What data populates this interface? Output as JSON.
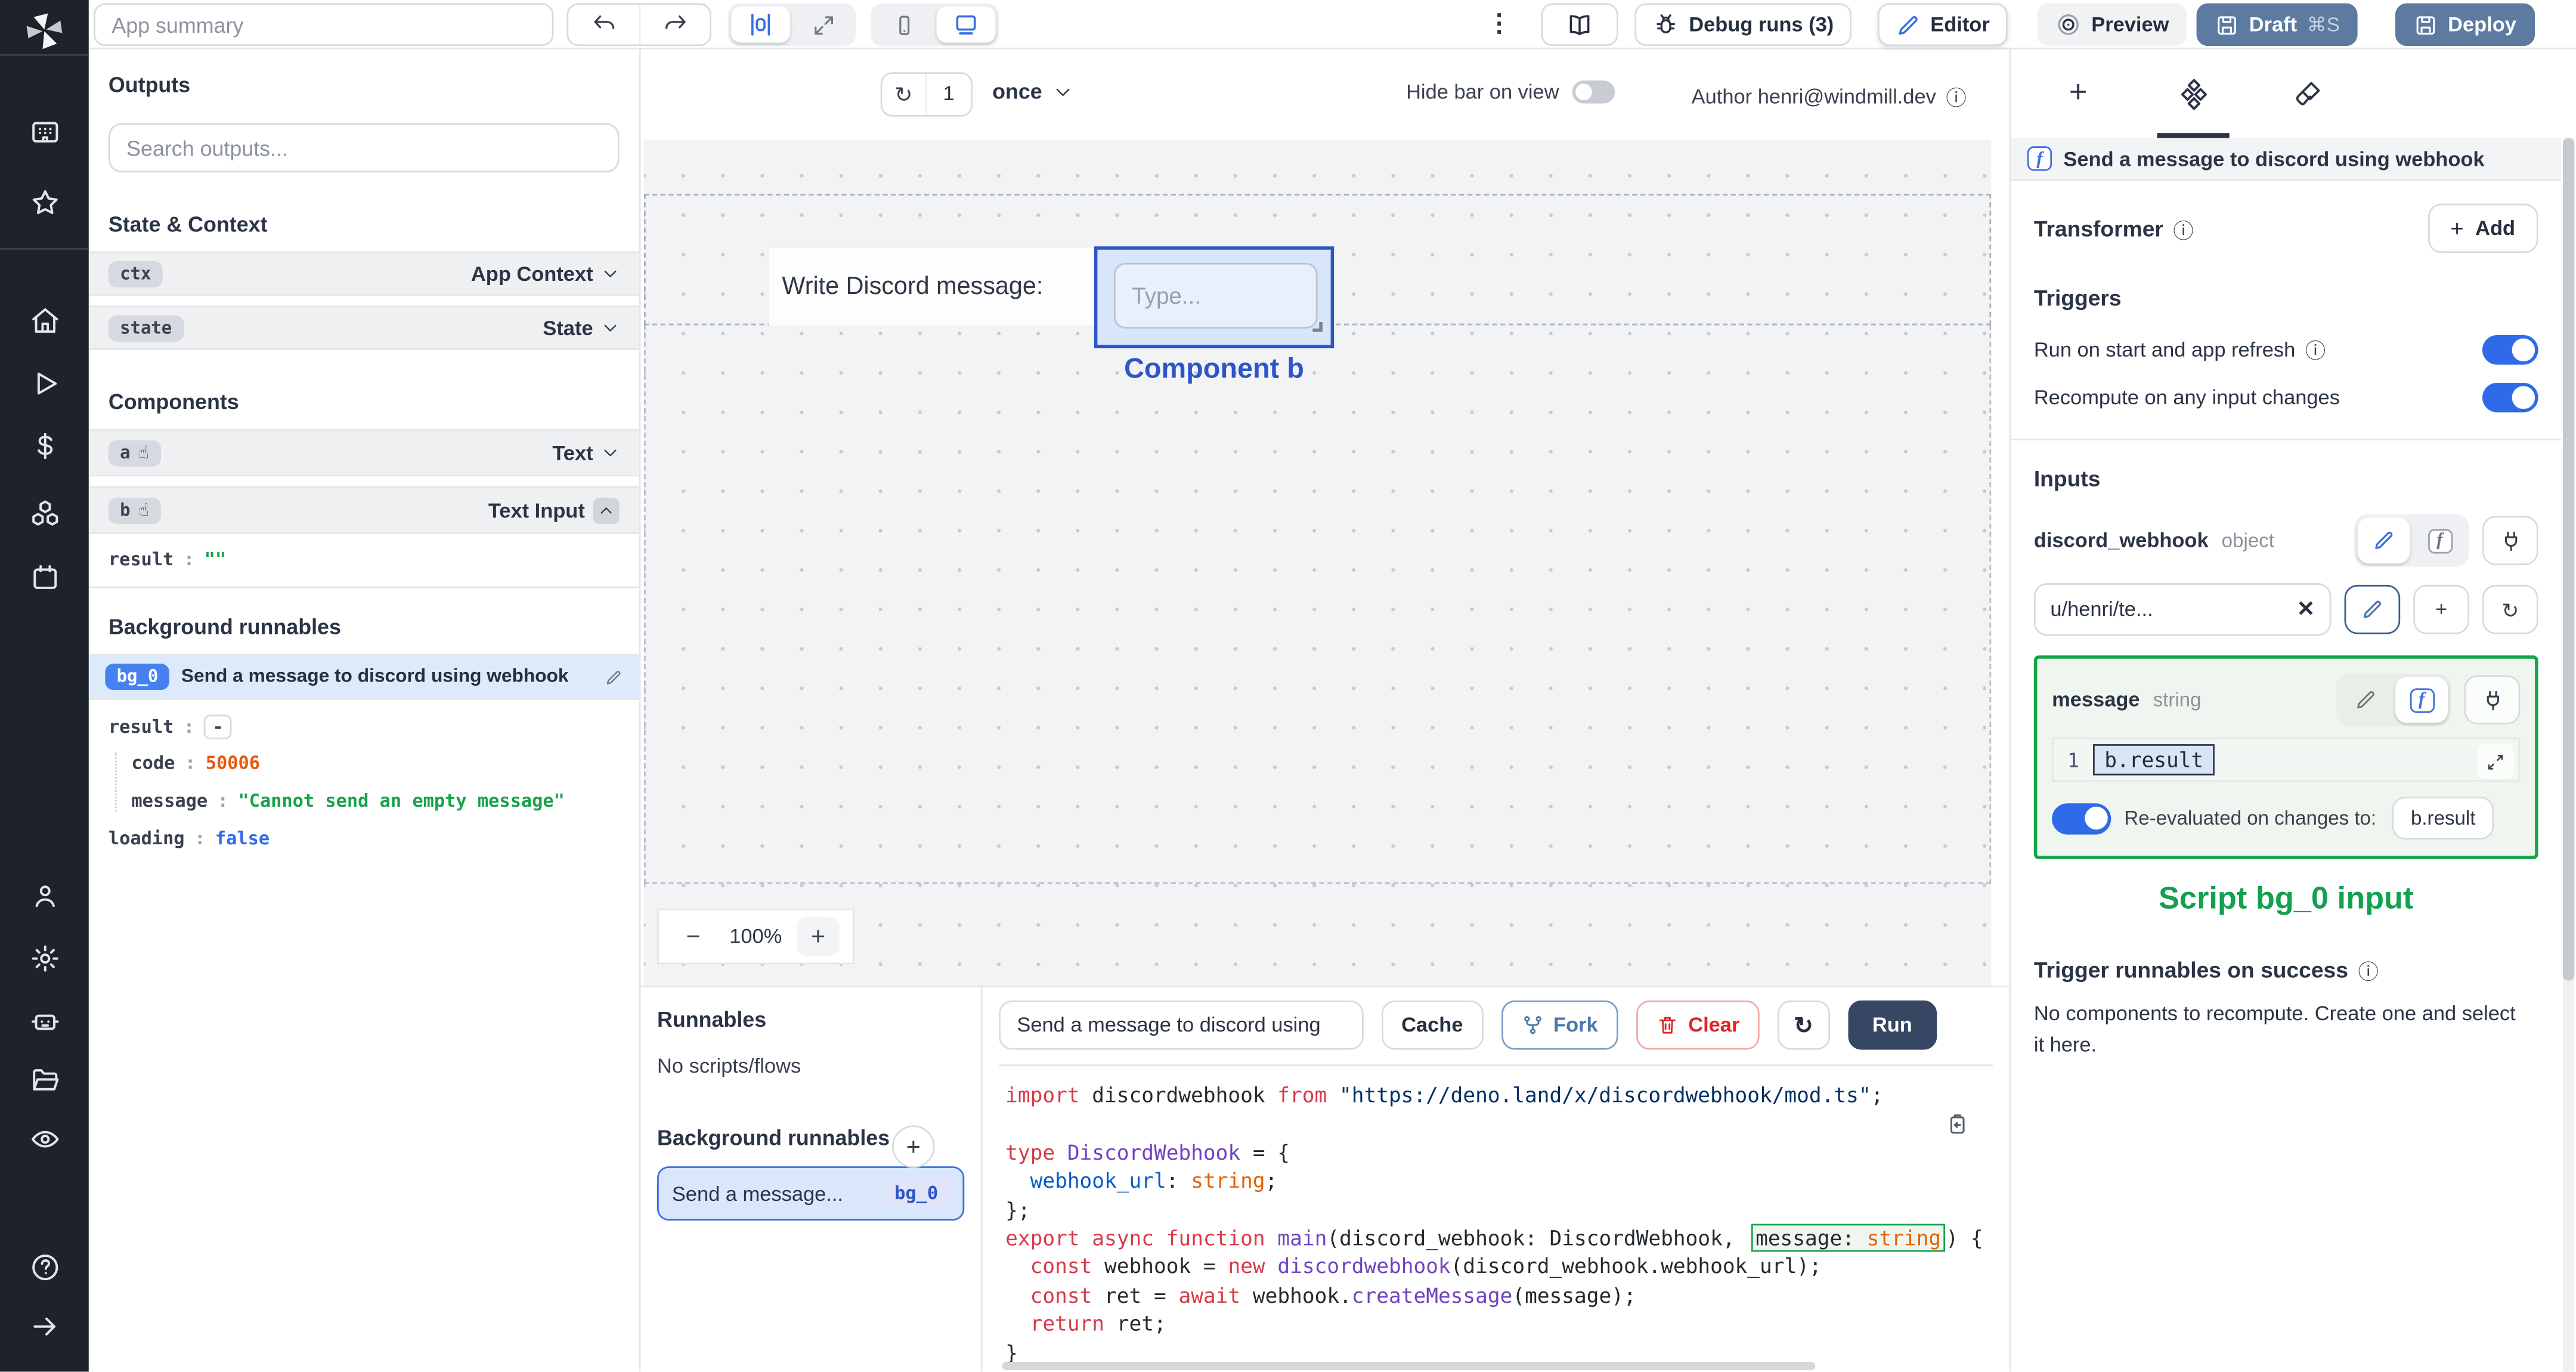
{
  "topbar": {
    "app_summary_placeholder": "App summary",
    "debug_runs_label": "Debug runs (3)",
    "editor_label": "Editor",
    "preview_label": "Preview",
    "draft_label": "Draft",
    "draft_shortcut": "⌘S",
    "deploy_label": "Deploy"
  },
  "icons": {
    "kebab": "⋮",
    "undo": "↶",
    "redo": "↷",
    "refresh": "↻",
    "pointer": "☝",
    "info": "ⓘ",
    "close": "✕",
    "function_glyph": "f",
    "minus": "−",
    "plus": "+"
  },
  "outputs_panel": {
    "title": "Outputs",
    "search_placeholder": "Search outputs...",
    "state_context_header": "State & Context",
    "components_header": "Components",
    "background_header": "Background runnables",
    "rows": {
      "ctx_badge": "ctx",
      "ctx_type": "App Context",
      "state_badge": "state",
      "state_type": "State",
      "a_badge": "a",
      "a_type": "Text",
      "b_badge": "b",
      "b_type": "Text Input",
      "b_result_key": "result",
      "b_result_colon": ":",
      "b_result_value": "\"\"",
      "bg0_badge": "bg_0",
      "bg0_label": "Send a message to discord using webhook",
      "bg0_result_key": "result",
      "bg0_result_value": "-",
      "bg0_code_key": "code",
      "bg0_code_value": "50006",
      "bg0_message_key": "message",
      "bg0_message_value": "\"Cannot send an empty message\"",
      "bg0_loading_key": "loading",
      "bg0_loading_value": "false"
    }
  },
  "canvas": {
    "refresh_count": "1",
    "mode": "once",
    "hide_bar_label": "Hide bar on view",
    "author_label": "Author henri@windmill.dev",
    "text_component": "Write Discord message:",
    "input_placeholder": "Type...",
    "selected_component_label": "Component b",
    "zoom_out": "−",
    "zoom_level": "100%",
    "zoom_in": "+"
  },
  "runnables_panel": {
    "title": "Runnables",
    "empty_label": "No scripts/flows",
    "background_title": "Background runnables",
    "item_label": "Send a message...",
    "item_badge": "bg_0"
  },
  "editor_panel": {
    "script_title": "Send a message to discord using",
    "cache_label": "Cache",
    "fork_label": "Fork",
    "clear_label": "Clear",
    "run_label": "Run"
  },
  "code": {
    "lines": [
      {
        "tokens": [
          {
            "t": "import",
            "c": "kw"
          },
          {
            "t": " discordwebhook ",
            "c": "pl"
          },
          {
            "t": "from",
            "c": "kw"
          },
          {
            "t": " ",
            "c": "pl"
          },
          {
            "t": "\"https://deno.land/x/discordwebhook/mod.ts\"",
            "c": "str"
          },
          {
            "t": ";",
            "c": "pl"
          }
        ]
      },
      {
        "tokens": []
      },
      {
        "tokens": [
          {
            "t": "type",
            "c": "kw"
          },
          {
            "t": " ",
            "c": "pl"
          },
          {
            "t": "DiscordWebhook",
            "c": "type"
          },
          {
            "t": " = {",
            "c": "pl"
          }
        ]
      },
      {
        "tokens": [
          {
            "t": "  ",
            "c": "pl"
          },
          {
            "t": "webhook_url",
            "c": "prop"
          },
          {
            "t": ": ",
            "c": "pl"
          },
          {
            "t": "string",
            "c": "tname"
          },
          {
            "t": ";",
            "c": "pl"
          }
        ]
      },
      {
        "tokens": [
          {
            "t": "};",
            "c": "pl"
          }
        ]
      },
      {
        "tokens": [
          {
            "t": "export",
            "c": "kw"
          },
          {
            "t": " ",
            "c": "pl"
          },
          {
            "t": "async",
            "c": "kw"
          },
          {
            "t": " ",
            "c": "pl"
          },
          {
            "t": "function",
            "c": "kw"
          },
          {
            "t": " ",
            "c": "pl"
          },
          {
            "t": "main",
            "c": "type"
          },
          {
            "t": "(discord_webhook: DiscordWebhook, ",
            "c": "pl"
          },
          {
            "group": [
              {
                "t": "message: ",
                "c": "pl"
              },
              {
                "t": "string",
                "c": "tname"
              }
            ]
          },
          {
            "t": ") {",
            "c": "pl"
          }
        ]
      },
      {
        "tokens": [
          {
            "t": "  ",
            "c": "pl"
          },
          {
            "t": "const",
            "c": "kw"
          },
          {
            "t": " webhook = ",
            "c": "pl"
          },
          {
            "t": "new",
            "c": "kw"
          },
          {
            "t": " ",
            "c": "pl"
          },
          {
            "t": "discordwebhook",
            "c": "type"
          },
          {
            "t": "(discord_webhook.webhook_url);",
            "c": "pl"
          }
        ]
      },
      {
        "tokens": [
          {
            "t": "  ",
            "c": "pl"
          },
          {
            "t": "const",
            "c": "kw"
          },
          {
            "t": " ret = ",
            "c": "pl"
          },
          {
            "t": "await",
            "c": "kw"
          },
          {
            "t": " webhook.",
            "c": "pl"
          },
          {
            "t": "createMessage",
            "c": "type"
          },
          {
            "t": "(message);",
            "c": "pl"
          }
        ]
      },
      {
        "tokens": [
          {
            "t": "  ",
            "c": "pl"
          },
          {
            "t": "return",
            "c": "kw"
          },
          {
            "t": " ret;",
            "c": "pl"
          }
        ]
      },
      {
        "tokens": [
          {
            "t": "}",
            "c": "pl"
          }
        ]
      }
    ]
  },
  "settings_panel": {
    "header_title": "Send a message to discord using webhook",
    "transformer_label": "Transformer",
    "add_label": "Add",
    "triggers_header": "Triggers",
    "run_on_start_label": "Run on start and app refresh",
    "recompute_label": "Recompute on any input changes",
    "inputs_header": "Inputs",
    "discord_webhook_name": "discord_webhook",
    "discord_webhook_type": "object",
    "discord_webhook_value": "u/henri/te...",
    "message_name": "message",
    "message_type": "string",
    "message_line_no": "1",
    "message_expr": "b.result",
    "reeval_label": "Re-evaluated on changes to:",
    "reeval_target": "b.result",
    "script_input_label": "Script bg_0 input",
    "trigger_success_header": "Trigger runnables on success",
    "no_components_text": "No components to recompute. Create one and select it here."
  }
}
